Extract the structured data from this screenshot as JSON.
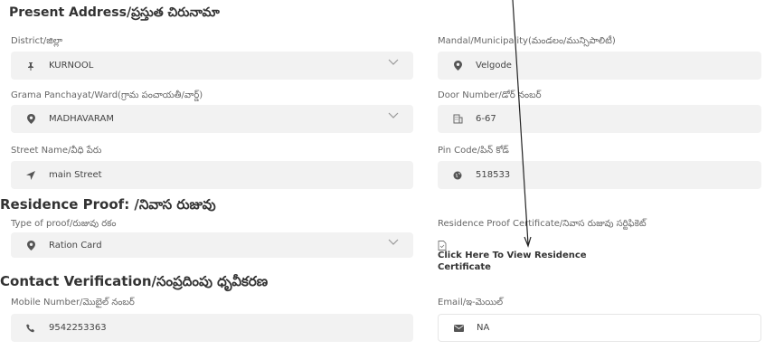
{
  "present": {
    "title": "Present Address/ప్రస్తుత చిరునామా",
    "district": {
      "label": "District/జిల్లా",
      "value": "KURNOOL",
      "icon": "pin-icon"
    },
    "mandal": {
      "label": "Mandal/Municipality(మండలం/మున్సిపాలిటీ)",
      "value": "Velgode",
      "icon": "map-marker-icon"
    },
    "grama": {
      "label": "Grama Panchayat/Ward(గ్రామ పంచాయతీ/వార్డ్)",
      "value": "MADHAVARAM",
      "icon": "map-marker-icon"
    },
    "door": {
      "label": "Door Number/డోర్ నంబర్",
      "value": "6-67",
      "icon": "building-icon"
    },
    "street": {
      "label": "Street Name/వీధి పేరు",
      "value": "main Street",
      "icon": "location-arrow-icon"
    },
    "pincode": {
      "label": "Pin Code/పిన్ కోడ్",
      "value": "518533",
      "icon": "globe-icon"
    }
  },
  "residence": {
    "title": "Residence Proof: /నివాస రుజువు",
    "proof_type": {
      "label": "Type of proof/రుజువు రకం",
      "value": "Ration Card",
      "icon": "map-marker-icon"
    },
    "certificate": {
      "label": "Residence Proof Certificate/నివాస రుజువు సర్టిఫికెట్",
      "link_text": "Click Here To View Residence Certificate",
      "icon": "file-icon"
    }
  },
  "contact": {
    "title": "Contact Verification/సంప్రదింపు ధృవీకరణ",
    "mobile": {
      "label": "Mobile Number/మొబైల్ నంబర్",
      "value": "9542253363",
      "icon": "phone-icon"
    },
    "email": {
      "label": "Email/ఇ-మెయిల్",
      "value": "NA",
      "icon": "envelope-icon"
    }
  }
}
